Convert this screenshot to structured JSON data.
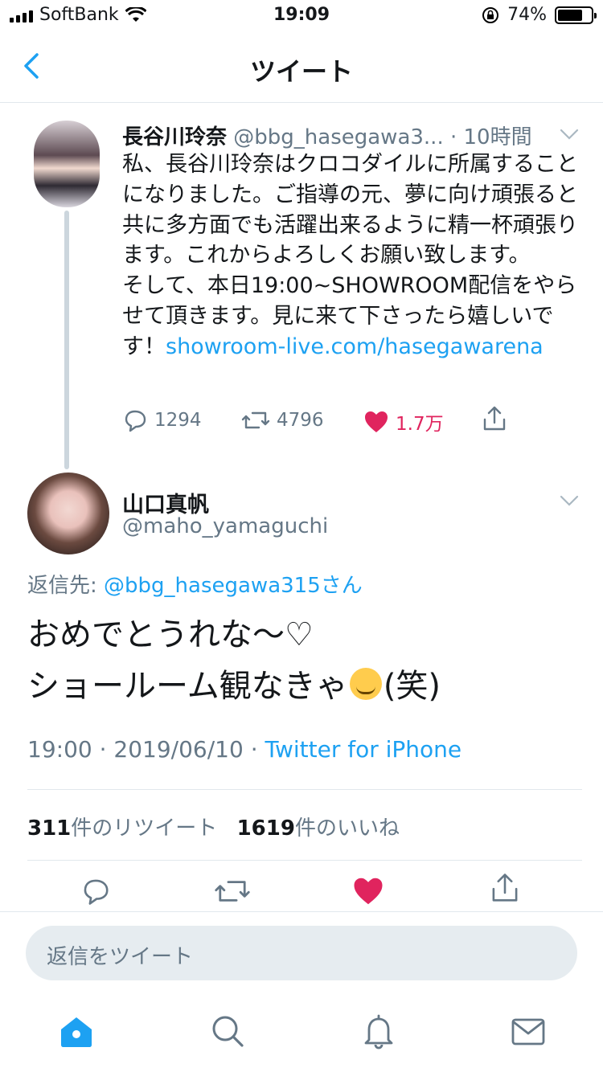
{
  "status": {
    "carrier": "SoftBank",
    "time": "19:09",
    "battery": "74%",
    "battery_level": 0.74
  },
  "nav": {
    "title": "ツイート",
    "back_icon": "chevron-left-icon"
  },
  "tweet1": {
    "name": "長谷川玲奈",
    "handle": "@bbg_hasegawa3...",
    "time_sep": " · ",
    "time": "10時間",
    "body": "私、長谷川玲奈はクロコダイルに所属することになりました。ご指導の元、夢に向け頑張ると共に多方面でも活躍出来るように精一杯頑張ります。これからよろしくお願い致します。\nそして、本日19:00~SHOWROOM配信をやらせて頂きます。見に来て下さったら嬉しいです！",
    "link": "showroom-live.com/hasegawarena",
    "replies": "1294",
    "retweets": "4796",
    "likes": "1.7万"
  },
  "tweet2": {
    "name": "山口真帆",
    "handle": "@maho_yamaguchi",
    "replying_label": "返信先: ",
    "replying_to": "@bbg_hasegawa315さん",
    "line1": "おめでとうれな〜♡",
    "line2a": "ショールーム観なきゃ",
    "line2b": "(笑)",
    "time": "19:00",
    "date": "2019/06/10",
    "source": "Twitter for iPhone",
    "retweet_count": "311",
    "retweet_label": "件のリツイート",
    "like_count": "1619",
    "like_label": "件のいいね"
  },
  "reply_box": {
    "placeholder": "返信をツイート"
  },
  "colors": {
    "accent": "#1da1f2",
    "like": "#e0245e",
    "muted": "#657786"
  }
}
